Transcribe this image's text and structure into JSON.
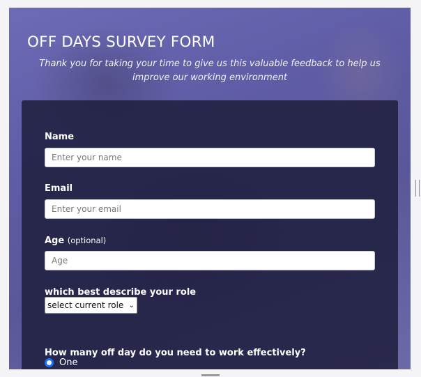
{
  "header": {
    "title": "OFF DAYS SURVEY FORM",
    "subtitle": "Thank you for taking your time to give us this valuable feedback to help us improve our working environment"
  },
  "form": {
    "name": {
      "label": "Name",
      "placeholder": "Enter your name"
    },
    "email": {
      "label": "Email",
      "placeholder": "Enter your email"
    },
    "age": {
      "label": "Age",
      "hint": "(optional)",
      "placeholder": "Age"
    },
    "role": {
      "label": "which best describe your role",
      "selected": "select current role"
    },
    "offdays": {
      "question": "How many off day do you need to work effectively?",
      "options": [
        "One"
      ]
    }
  },
  "colors": {
    "radio_accent": "#1a6ff5",
    "form_bg": "#1e1e3e"
  }
}
